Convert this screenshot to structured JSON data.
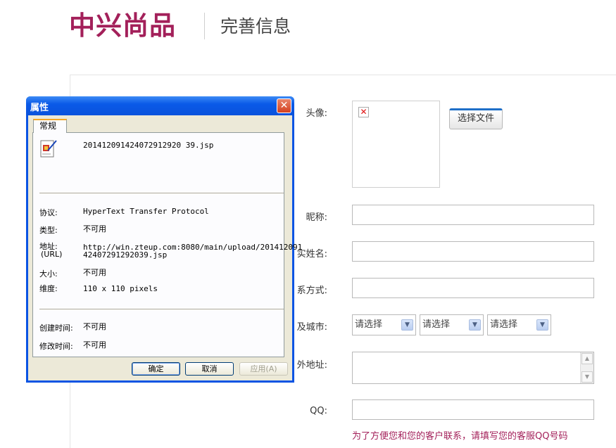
{
  "header": {
    "logo_text": "中兴尚品",
    "page_title": "完善信息"
  },
  "form": {
    "avatar_label": "头像:",
    "choose_file_label": "选择文件",
    "broken_image_icon": "x-mark",
    "nickname_label": "昵称:",
    "realname_label": "实姓名:",
    "contact_label": "系方式:",
    "region_label": "及城市:",
    "selects": [
      {
        "value": "请选择"
      },
      {
        "value": "请选择"
      },
      {
        "value": "请选择"
      }
    ],
    "address_label": "外地址:",
    "qq_label": "QQ:",
    "qq_hint": "为了方便您和您的客户联系，请填写您的客服QQ号码",
    "accent_color": "#a3205a"
  },
  "dialog": {
    "title": "属性",
    "tab_label": "常规",
    "filename": "201412091424072912920 39.jsp",
    "props": [
      {
        "label": "协议:",
        "value": "HyperText Transfer Protocol"
      },
      {
        "label": "类型:",
        "value": "不可用"
      },
      {
        "label": "地址:",
        "label2": "(URL)",
        "value": "http://win.zteup.com:8080/main/upload/201412091",
        "value2": "42407291292039.jsp"
      },
      {
        "label": "大小:",
        "value": "不可用"
      },
      {
        "label": "维度:",
        "value": "110  x  110  pixels"
      }
    ],
    "created_label": "创建时间:",
    "created_value": "不可用",
    "modified_label": "修改时间:",
    "modified_value": "不可用",
    "ok_label": "确定",
    "cancel_label": "取消",
    "apply_label": "应用(A)"
  }
}
